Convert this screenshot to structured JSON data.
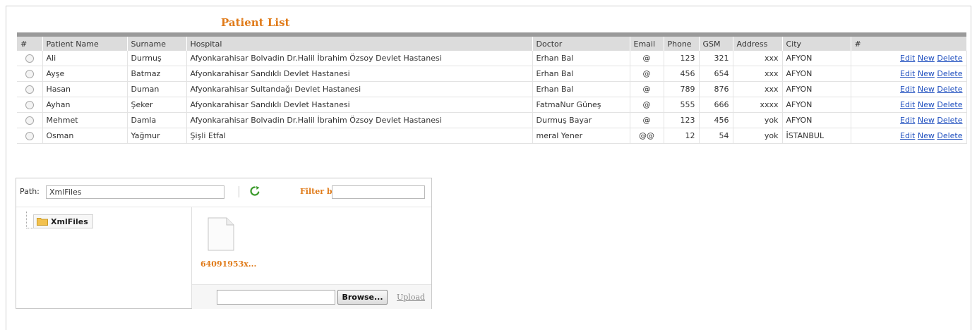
{
  "page": {
    "title": "Patient List"
  },
  "table": {
    "columns": [
      "#",
      "Patient Name",
      "Surname",
      "Hospital",
      "Doctor",
      "Email",
      "Phone",
      "GSM",
      "Address",
      "City",
      "#"
    ],
    "rows": [
      {
        "name": "Ali",
        "surname": "Durmuş",
        "hospital": "Afyonkarahisar Bolvadin Dr.Halil İbrahim Özsoy Devlet Hastanesi",
        "doctor": "Erhan Bal",
        "email": "@",
        "phone": "123",
        "gsm": "321",
        "address": "xxx",
        "city": "AFYON"
      },
      {
        "name": "Ayşe",
        "surname": "Batmaz",
        "hospital": "Afyonkarahisar Sandıklı Devlet Hastanesi",
        "doctor": "Erhan Bal",
        "email": "@",
        "phone": "456",
        "gsm": "654",
        "address": "xxx",
        "city": "AFYON"
      },
      {
        "name": "Hasan",
        "surname": "Duman",
        "hospital": "Afyonkarahisar Sultandağı Devlet Hastanesi",
        "doctor": "Erhan Bal",
        "email": "@",
        "phone": "789",
        "gsm": "876",
        "address": "xxx",
        "city": "AFYON"
      },
      {
        "name": "Ayhan",
        "surname": "Şeker",
        "hospital": "Afyonkarahisar Sandıklı Devlet Hastanesi",
        "doctor": "FatmaNur Güneş",
        "email": "@",
        "phone": "555",
        "gsm": "666",
        "address": "xxxx",
        "city": "AFYON"
      },
      {
        "name": "Mehmet",
        "surname": "Damla",
        "hospital": "Afyonkarahisar Bolvadin Dr.Halil İbrahim Özsoy Devlet Hastanesi",
        "doctor": "Durmuş Bayar",
        "email": "@",
        "phone": "123",
        "gsm": "456",
        "address": "yok",
        "city": "AFYON"
      },
      {
        "name": "Osman",
        "surname": "Yağmur",
        "hospital": "Şişli Etfal",
        "doctor": "meral Yener",
        "email": "@@",
        "phone": "12",
        "gsm": "54",
        "address": "yok",
        "city": "İSTANBUL"
      }
    ],
    "actions": {
      "edit": "Edit",
      "new": "New",
      "delete": "Delete"
    }
  },
  "file_manager": {
    "path_label": "Path:",
    "path_value": "XmlFiles",
    "refresh_icon": "refresh-icon",
    "filter_label": "Filter by:",
    "filter_value": "",
    "tree_root": "XmlFiles",
    "files": [
      {
        "name": "64091953x..."
      }
    ],
    "browse_label": "Browse...",
    "upload_label": "Upload"
  },
  "colors": {
    "accent": "#e07b1a",
    "link": "#1f4fbf",
    "header_bg": "#dcdcdc",
    "header_bar": "#9a9a9a"
  }
}
